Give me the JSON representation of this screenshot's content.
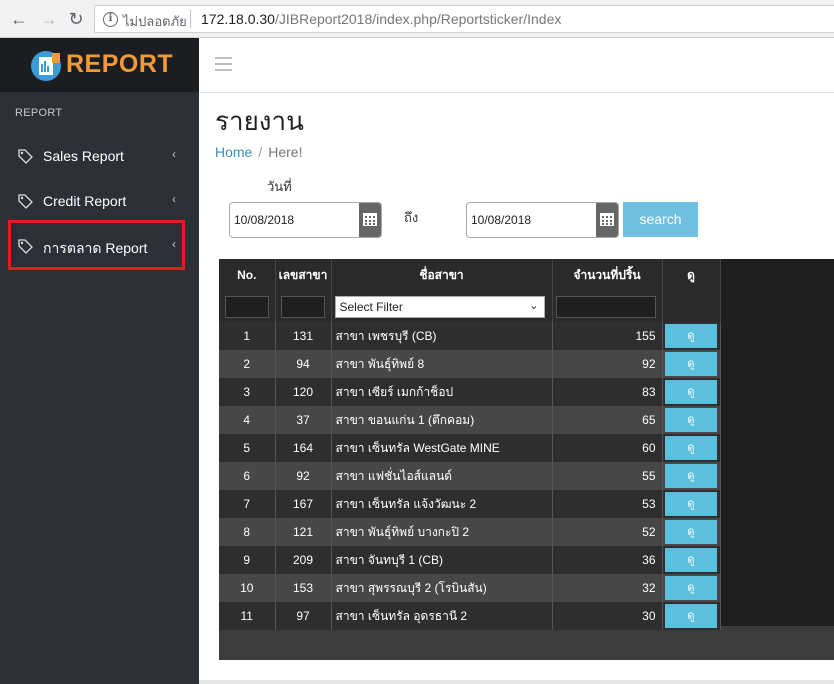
{
  "browser": {
    "security_label": "ไม่ปลอดภัย",
    "url_host": "172.18.0.30",
    "url_path": "/JIBReport2018/index.php/Reportsticker/Index"
  },
  "sidebar": {
    "logo": "REPORT",
    "header": "REPORT",
    "items": [
      {
        "label": "Sales Report",
        "icon": "tag-icon"
      },
      {
        "label": "Credit Report",
        "icon": "tag-icon"
      },
      {
        "label": "การตลาด Report",
        "icon": "tag-icon"
      }
    ],
    "highlight_color": "#e01e1e"
  },
  "main": {
    "title": "รายงาน",
    "breadcrumb": {
      "home": "Home",
      "separator": "/",
      "current": "Here!"
    },
    "date_label": "วันที่",
    "to_label": "ถึง",
    "date_from": "10/08/2018",
    "date_to": "10/08/2018",
    "search_label": "search"
  },
  "table": {
    "headers": [
      "No.",
      "เลขสาขา",
      "ชื่อสาขา",
      "จำนวนที่ปริ้น",
      "ดู"
    ],
    "filter_select": "Select Filter",
    "view_label": "ดู",
    "rows": [
      {
        "no": "1",
        "code": "131",
        "name": "สาขา เพชรบุรี (CB)",
        "count": "155"
      },
      {
        "no": "2",
        "code": "94",
        "name": "สาขา พันธุ์ทิพย์ 8",
        "count": "92"
      },
      {
        "no": "3",
        "code": "120",
        "name": "สาขา เซียร์ เมกก้าช็อป",
        "count": "83"
      },
      {
        "no": "4",
        "code": "37",
        "name": "สาขา ขอนแก่น 1 (ตึกคอม)",
        "count": "65"
      },
      {
        "no": "5",
        "code": "164",
        "name": "สาขา เซ็นทรัล WestGate MINE",
        "count": "60"
      },
      {
        "no": "6",
        "code": "92",
        "name": "สาขา แฟชั่นไอส์แลนด์",
        "count": "55"
      },
      {
        "no": "7",
        "code": "167",
        "name": "สาขา เซ็นทรัล แจ้งวัฒนะ 2",
        "count": "53"
      },
      {
        "no": "8",
        "code": "121",
        "name": "สาขา พันธุ์ทิพย์ บางกะปิ 2",
        "count": "52"
      },
      {
        "no": "9",
        "code": "209",
        "name": "สาขา จันทบุรี 1 (CB)",
        "count": "36"
      },
      {
        "no": "10",
        "code": "153",
        "name": "สาขา สุพรรณบุรี 2 (โรบินสัน)",
        "count": "32"
      },
      {
        "no": "11",
        "code": "97",
        "name": "สาขา เซ็นทรัล อุดรธานี 2",
        "count": "30"
      }
    ]
  }
}
